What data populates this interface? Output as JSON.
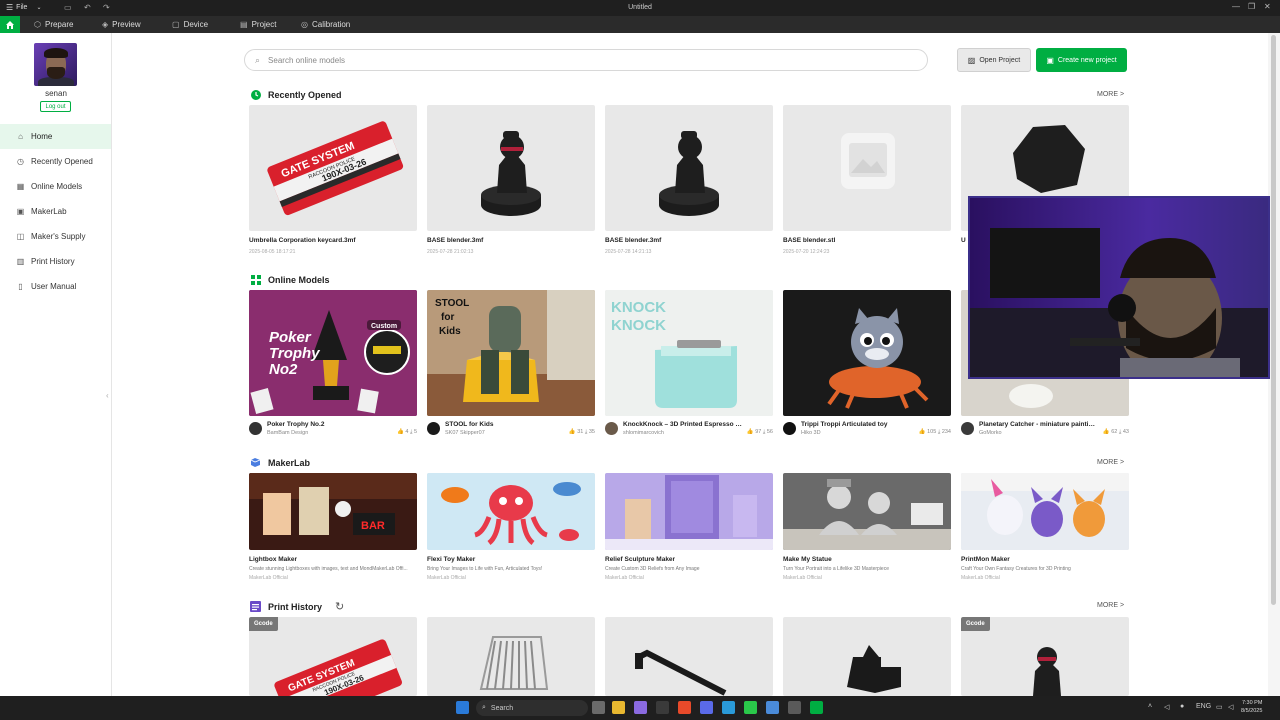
{
  "titlebar": {
    "file_menu": "File",
    "window_title": "Untitled"
  },
  "tabs": [
    {
      "label": "Prepare"
    },
    {
      "label": "Preview"
    },
    {
      "label": "Device"
    },
    {
      "label": "Project"
    },
    {
      "label": "Calibration"
    }
  ],
  "user": {
    "name": "senan",
    "logout_label": "Log out"
  },
  "nav": [
    {
      "label": "Home"
    },
    {
      "label": "Recently Opened"
    },
    {
      "label": "Online Models"
    },
    {
      "label": "MakerLab"
    },
    {
      "label": "Maker's Supply"
    },
    {
      "label": "Print History"
    },
    {
      "label": "User Manual"
    }
  ],
  "search": {
    "placeholder": "Search online models"
  },
  "buttons": {
    "open_project": "Open Project",
    "create_project": "Create new project"
  },
  "more_label": "MORE >",
  "sections": {
    "recent": {
      "title": "Recently Opened",
      "items": [
        {
          "title": "Umbrella Corporation keycard.3mf",
          "date": "2025-08-05 18:17:21"
        },
        {
          "title": "BASE blender.3mf",
          "date": "2025-07-28 21:02:13"
        },
        {
          "title": "BASE blender.3mf",
          "date": "2025-07-28 14:21:13"
        },
        {
          "title": "BASE blender.stl",
          "date": "2025-07-20 12:24:23"
        },
        {
          "title": "U",
          "date": ""
        }
      ]
    },
    "online": {
      "title": "Online Models",
      "items": [
        {
          "title": "Poker Trophy No.2",
          "author": "BamBam Design",
          "likes": "4",
          "downloads": "5"
        },
        {
          "title": "STOOL for Kids",
          "author": "SK07 Skipper07",
          "likes": "31",
          "downloads": "35"
        },
        {
          "title": "KnockKnock – 3D Printed Espresso Knock...",
          "author": "shlomimarcovich",
          "likes": "97",
          "downloads": "56"
        },
        {
          "title": "Trippi Troppi Articulated toy",
          "author": "Hiko 3D",
          "likes": "105",
          "downloads": "234"
        },
        {
          "title": "Planetary Catcher - miniature painting h...",
          "author": "GoMorko",
          "likes": "62",
          "downloads": "43"
        }
      ]
    },
    "makerlab": {
      "title": "MakerLab",
      "items": [
        {
          "title": "Lightbox Maker",
          "desc": "Create stunning Lightboxes with images, text and MondMakerLab Offi...",
          "author": "MakerLab Official"
        },
        {
          "title": "Flexi Toy Maker",
          "desc": "Bring Your Images to Life with Fun, Articulated Toys!",
          "author": "MakerLab Official"
        },
        {
          "title": "Relief Sculpture Maker",
          "desc": "Create Custom 3D Reliefs from Any Image",
          "author": "MakerLab Official"
        },
        {
          "title": "Make My Statue",
          "desc": "Turn Your Portrait into a Lifelike 3D Masterpiece",
          "author": "MakerLab Official"
        },
        {
          "title": "PrintMon Maker",
          "desc": "Craft Your Own Fantasy Creatures for 3D Printing",
          "author": "MakerLab Official"
        }
      ]
    },
    "history": {
      "title": "Print History",
      "badge": "Gcode"
    }
  },
  "thumb_text": {
    "keycard_line1": "GATE SYSTEM",
    "keycard_line2": "RACCOON POLICE",
    "keycard_line3": "190X-03-26",
    "poker_line1": "Poker",
    "poker_line2": "Trophy",
    "poker_line3": "No2",
    "poker_tag": "Custom",
    "stool_line1": "STOOL",
    "stool_line2": "for",
    "stool_line3": "Kids",
    "knock_line1": "KNOCK",
    "knock_line2": "KNOCK",
    "lightbox_sign": "BAR"
  },
  "taskbar": {
    "search_label": "Search",
    "lang": "ENG",
    "time": "7:30 PM",
    "date": "8/5/2025"
  },
  "colors": {
    "accent": "#00ae42",
    "titlebar": "#1f1f1f",
    "tabbar": "#2b2b2b"
  }
}
